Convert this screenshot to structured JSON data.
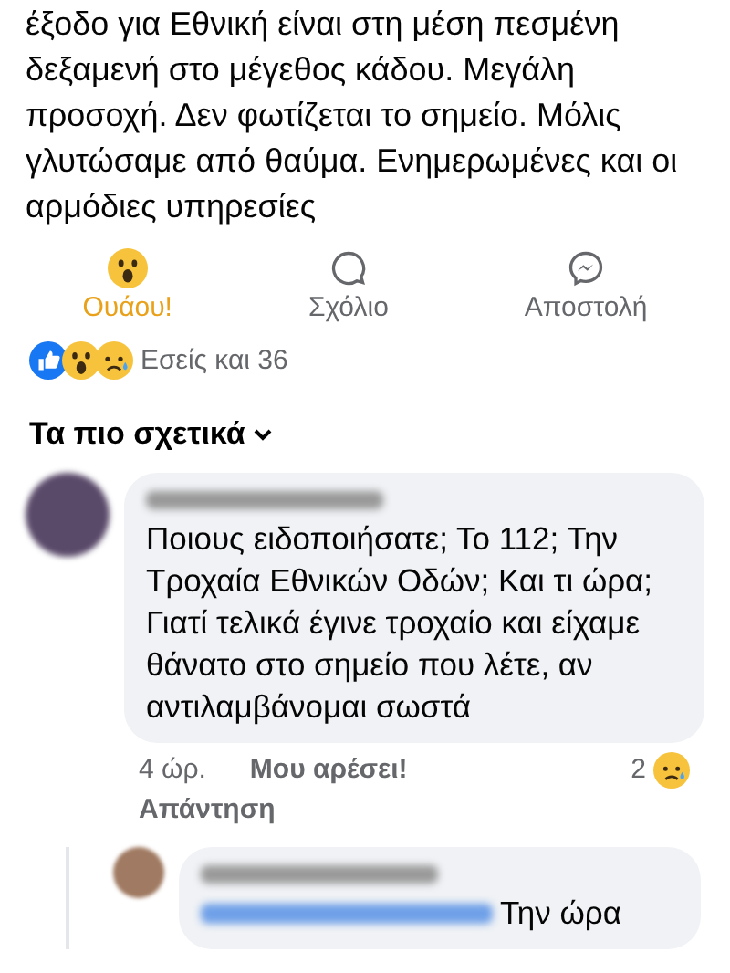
{
  "post": {
    "text_lines": [
      "έξοδο για Εθνική είναι στη μέση πεσμένη",
      "δεξαμενή στο μέγεθος κάδου. Μεγάλη",
      "προσοχή. Δεν φωτίζεται το σημείο. Μόλις",
      "γλυτώσαμε από θαύμα. Ενημερωμένες και οι",
      "αρμόδιες υπηρεσίες"
    ]
  },
  "actions": [
    {
      "kind": "wow",
      "label": "Ουάου!",
      "selected": true
    },
    {
      "kind": "comment",
      "label": "Σχόλιο",
      "selected": false
    },
    {
      "kind": "messenger",
      "label": "Αποστολή",
      "selected": false
    }
  ],
  "reactions": {
    "icons": [
      {
        "kind": "like"
      },
      {
        "kind": "wow"
      },
      {
        "kind": "sad"
      }
    ],
    "summary": "Εσείς και 36"
  },
  "sort": {
    "label": "Τα πιο σχετικά"
  },
  "comments": [
    {
      "text": "Ποιους ειδοποιήσατε; Το 112; Την Τροχαία Εθνικών Οδών; Και τι ώρα; Γιατί τελικά έγινε τροχαίο και είχαμε θάνατο στο σημείο που λέτε, αν αντιλαμβάνομαι σωστά",
      "time": "4 ώρ.",
      "like": "Μου αρέσει!",
      "reply": "Απάντηση",
      "reaction_count": "2",
      "reaction_icon": {
        "kind": "sad"
      },
      "replies": [
        {
          "text": "Την ώρα"
        }
      ]
    }
  ]
}
